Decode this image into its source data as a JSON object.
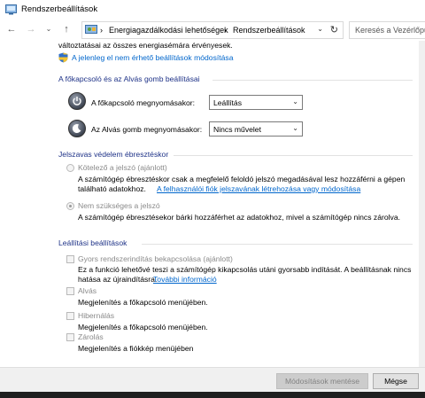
{
  "window": {
    "title": "Rendszerbeállítások"
  },
  "address": {
    "crumb1": "Energiagazdálkodási lehetőségek",
    "separator": "›",
    "crumb2": "Rendszerbeállítások",
    "search_placeholder": "Keresés a Vezérlőpult"
  },
  "top": {
    "line": "változtatásai az összes energiasémára érvényesek.",
    "change_link": "A jelenleg el nem érhető beállítások módosítása"
  },
  "power_section": {
    "heading": "A főkapcsoló és az Alvás gomb beállításai",
    "power_label": "A főkapcsoló megnyomásakor:",
    "power_value": "Leállítás",
    "sleep_label": "Az Alvás gomb megnyomásakor:",
    "sleep_value": "Nincs művelet"
  },
  "password_section": {
    "heading": "Jelszavas védelem ébresztéskor",
    "opt1_label": "Kötelező a jelszó (ajánlott)",
    "opt1_desc1": "A számítógép ébresztéskor csak a megfelelő feloldó jelszó megadásával lesz hozzáférni a gépen",
    "opt1_desc2": "található adatokhoz.",
    "opt1_link": "A felhasználói fiók jelszavának létrehozása vagy módosítása",
    "opt2_label": "Nem szükséges a jelszó",
    "opt2_desc": "A számítógép ébresztésekor bárki hozzáférhet az adatokhoz, mivel a számítógép nincs zárolva."
  },
  "shutdown_section": {
    "heading": "Leállítási beállítások",
    "fast_label": "Gyors rendszerindítás bekapcsolása (ajánlott)",
    "fast_desc1": "Ez a funkció lehetővé teszi a számítógép kikapcsolás utáni gyorsabb indítását. A beállításnak nincs",
    "fast_desc2": "hatása az újraindításra.",
    "fast_link": "További információ",
    "sleep_label": "Alvás",
    "sleep_desc": "Megjelenítés a főkapcsoló menüjében.",
    "hibernate_label": "Hibernálás",
    "hibernate_desc": "Megjelenítés a főkapcsoló menüjében.",
    "lock_label": "Zárolás",
    "lock_desc": "Megjelenítés a fiókkép menüjében"
  },
  "buttons": {
    "save": "Módosítások mentése",
    "cancel": "Mégse"
  },
  "colors": {
    "link": "#0066cc",
    "heading": "#1e3287"
  }
}
